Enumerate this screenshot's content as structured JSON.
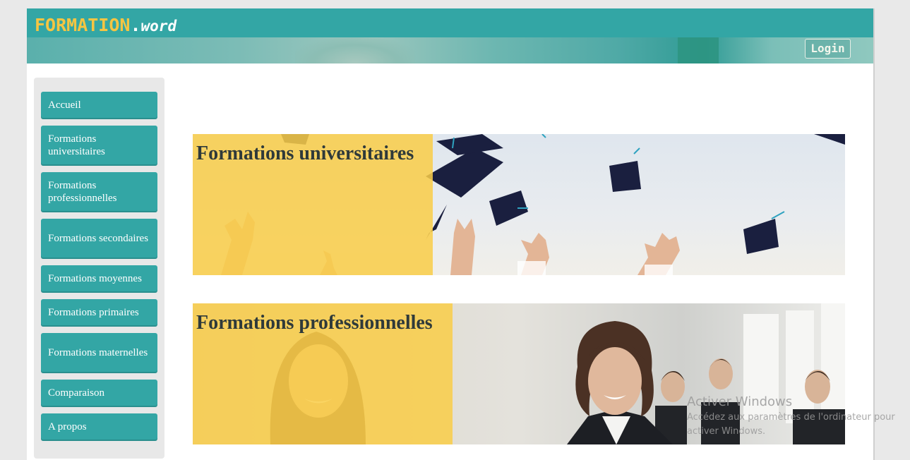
{
  "header": {
    "logo_brand": "FORMATION",
    "logo_dot": ".",
    "logo_suffix": "word",
    "login_label": "Login"
  },
  "sidebar": {
    "items": [
      {
        "label": "Accueil",
        "name": "sidebar-item-accueil"
      },
      {
        "label": "Formations universitaires",
        "name": "sidebar-item-formations-universitaires"
      },
      {
        "label": "Formations professionnelles",
        "name": "sidebar-item-formations-professionnelles"
      },
      {
        "label": "Formations secondaires",
        "name": "sidebar-item-formations-secondaires"
      },
      {
        "label": "Formations moyennes",
        "name": "sidebar-item-formations-moyennes"
      },
      {
        "label": "Formations primaires",
        "name": "sidebar-item-formations-primaires"
      },
      {
        "label": "Formations maternelles",
        "name": "sidebar-item-formations-maternelles"
      },
      {
        "label": "Comparaison",
        "name": "sidebar-item-comparaison"
      },
      {
        "label": "A propos",
        "name": "sidebar-item-a-propos"
      }
    ]
  },
  "main": {
    "cards": [
      {
        "title": "Formations universitaires",
        "image": "graduation-caps-photo"
      },
      {
        "title": "Formations professionnelles",
        "image": "business-woman-photo"
      }
    ]
  },
  "watermark": {
    "title": "Activer Windows",
    "subtitle": "Accédez aux paramètres de l'ordinateur pour activer Windows."
  },
  "colors": {
    "accent": "#33a6a5",
    "logo_brand": "#f5c542",
    "card_overlay": "#f9cd48",
    "sidebar_bg": "#e8e8e8",
    "page_bg": "#e9e9e9"
  }
}
